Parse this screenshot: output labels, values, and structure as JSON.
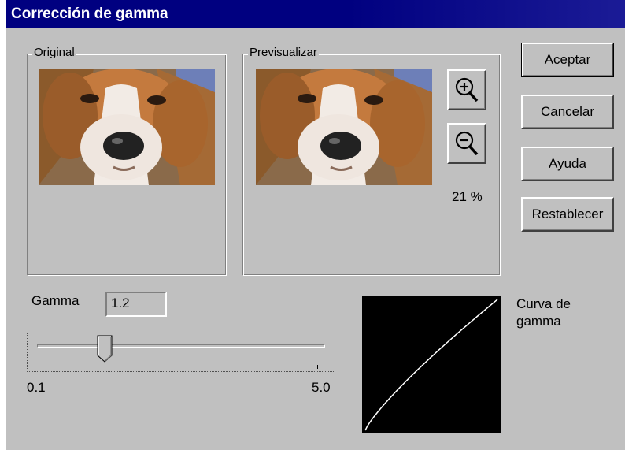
{
  "window": {
    "title": "Corrección de gamma"
  },
  "original_group": {
    "label": "Original"
  },
  "preview_group": {
    "label": "Previsualizar",
    "zoom_in_icon": "zoom-in-magnifier",
    "zoom_out_icon": "zoom-out-magnifier",
    "zoom_level": "21 %"
  },
  "buttons": {
    "accept": "Aceptar",
    "cancel": "Cancelar",
    "help": "Ayuda",
    "reset": "Restablecer"
  },
  "gamma": {
    "label": "Gamma",
    "value": "1.2",
    "slider_min_label": "0.1",
    "slider_max_label": "5.0",
    "slider_min": 0.1,
    "slider_max": 5.0,
    "slider_value": 1.2
  },
  "curve": {
    "label_line1": "Curva de",
    "label_line2": "gamma",
    "background_color": "#000000",
    "line_color": "#ffffff"
  },
  "colors": {
    "title_bar": "#000080",
    "dialog_face": "#c0c0c0"
  }
}
